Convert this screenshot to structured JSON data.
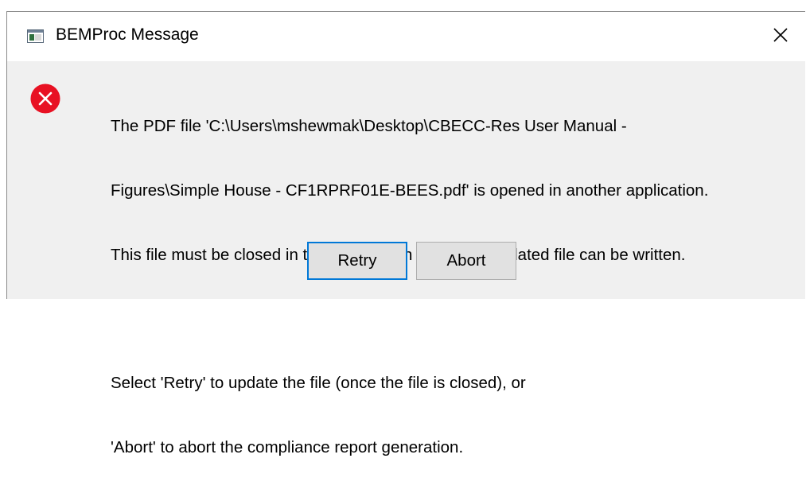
{
  "window": {
    "title": "BEMProc Message",
    "app_icon": "window-app-icon",
    "close_icon": "close-x-icon"
  },
  "message": {
    "icon": "error-icon",
    "icon_color": "#e81123",
    "lines": [
      "The PDF file 'C:\\Users\\mshewmak\\Desktop\\CBECC-Res User Manual -",
      "Figures\\Simple House - CF1RPRF01E-BEES.pdf' is opened in another application.",
      "This file must be closed in that application before an updated file can be written.",
      "Select 'Retry' to update the file (once the file is closed), or",
      "'Abort' to abort the compliance report generation."
    ]
  },
  "buttons": {
    "retry_label": "Retry",
    "abort_label": "Abort"
  },
  "colors": {
    "dialog_bg": "#f0f0f0",
    "title_bg": "#ffffff",
    "focus_border": "#0078d7"
  }
}
